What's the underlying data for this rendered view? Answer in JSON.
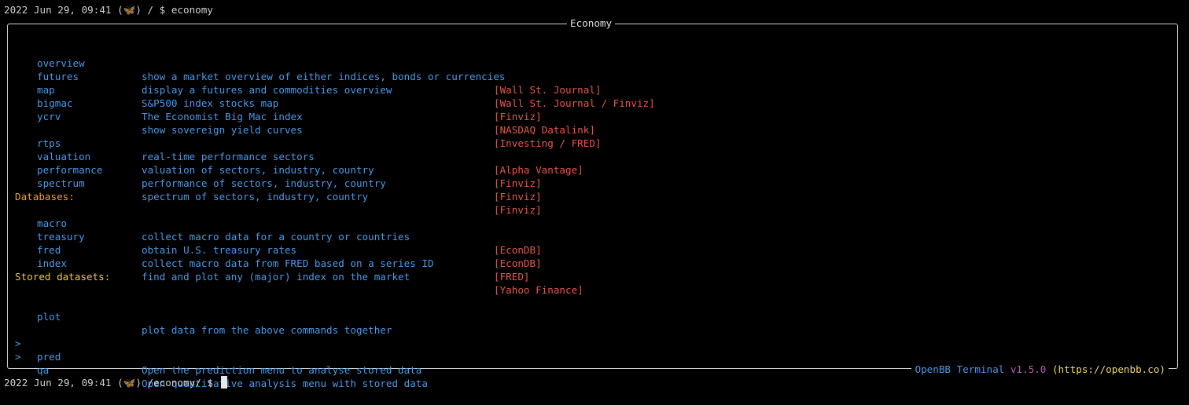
{
  "prompt_top": {
    "datetime": "2022 Jun 29, 09:41",
    "icon": "butterfly-icon",
    "path": "/ $ economy"
  },
  "panel": {
    "title": "Economy",
    "footer": {
      "openbb": "OpenBB",
      "terminal": "Terminal",
      "version": "v1.5.0",
      "url": "(https://openbb.co)"
    }
  },
  "commands_main": [
    {
      "cmd": "overview",
      "desc": "show a market overview of either indices, bonds or currencies",
      "src": "[Wall St. Journal]"
    },
    {
      "cmd": "futures",
      "desc": "display a futures and commodities overview",
      "src": "[Wall St. Journal / Finviz]"
    },
    {
      "cmd": "map",
      "desc": "S&P500 index stocks map",
      "src": "[Finviz]"
    },
    {
      "cmd": "bigmac",
      "desc": "The Economist Big Mac index",
      "src": "[NASDAQ Datalink]"
    },
    {
      "cmd": "ycrv",
      "desc": "show sovereign yield curves",
      "src": "[Investing / FRED]"
    }
  ],
  "commands_perf": [
    {
      "cmd": "rtps",
      "desc": "real-time performance sectors",
      "src": "[Alpha Vantage]"
    },
    {
      "cmd": "valuation",
      "desc": "valuation of sectors, industry, country",
      "src": "[Finviz]"
    },
    {
      "cmd": "performance",
      "desc": "performance of sectors, industry, country",
      "src": "[Finviz]"
    },
    {
      "cmd": "spectrum",
      "desc": "spectrum of sectors, industry, country",
      "src": "[Finviz]"
    }
  ],
  "databases": {
    "label": "Databases:",
    "commands": [
      {
        "cmd": "macro",
        "desc": "collect macro data for a country or countries",
        "src": "[EconDB]"
      },
      {
        "cmd": "treasury",
        "desc": "obtain U.S. treasury rates",
        "src": "[EconDB]"
      },
      {
        "cmd": "fred",
        "desc": "collect macro data from FRED based on a series ID",
        "src": "[FRED]"
      },
      {
        "cmd": "index",
        "desc": "find and plot any (major) index on the market",
        "src": "[Yahoo Finance]"
      }
    ]
  },
  "stored": {
    "label": "Stored datasets:",
    "plot": {
      "cmd": "plot",
      "desc": "plot data from the above commands together"
    },
    "menus": [
      {
        "arrow": ">",
        "cmd": "pred",
        "desc": "Open the prediction menu to analyse stored data"
      },
      {
        "arrow": ">",
        "cmd": "qa",
        "desc": "Open quantitative analysis menu with stored data"
      }
    ]
  },
  "prompt_bottom": {
    "datetime": "2022 Jun 29, 09:41",
    "icon": "butterfly-icon",
    "path": "/economy/ $"
  },
  "colors": {
    "command": "#4a9ae8",
    "source": "#e8574a",
    "section": "#f0a030",
    "background": "#000000"
  }
}
